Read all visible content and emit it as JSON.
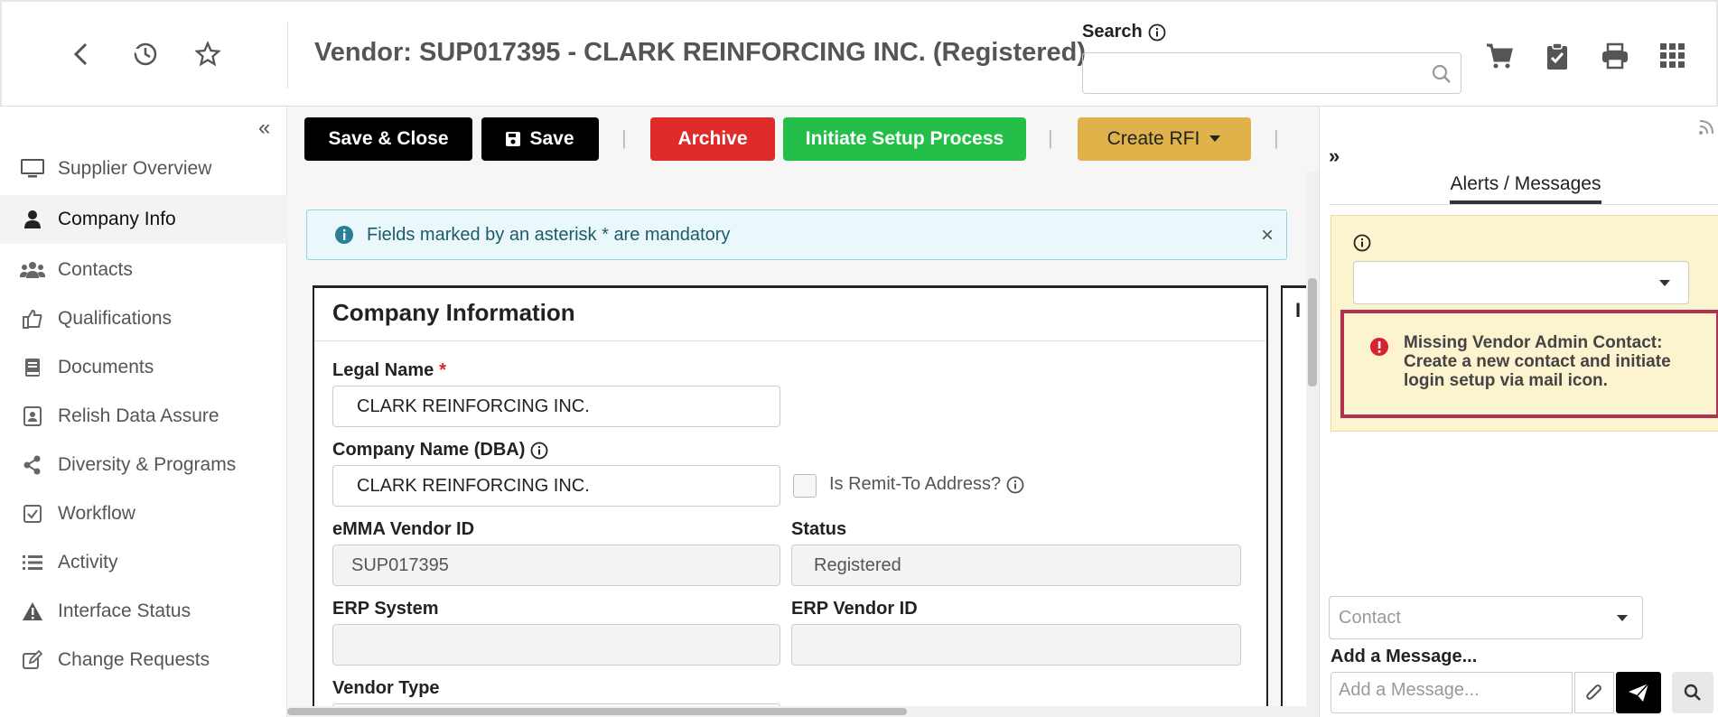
{
  "header": {
    "title": "Vendor: SUP017395 - CLARK REINFORCING INC. (Registered)",
    "search_label": "Search",
    "search_value": ""
  },
  "sidebar": {
    "items": [
      {
        "label": "Supplier Overview",
        "icon": "monitor-icon"
      },
      {
        "label": "Company Info",
        "icon": "user-icon",
        "active": true
      },
      {
        "label": "Contacts",
        "icon": "users-icon"
      },
      {
        "label": "Qualifications",
        "icon": "thumbs-up-icon"
      },
      {
        "label": "Documents",
        "icon": "book-icon"
      },
      {
        "label": "Relish Data Assure",
        "icon": "id-card-icon"
      },
      {
        "label": "Diversity & Programs",
        "icon": "share-icon"
      },
      {
        "label": "Workflow",
        "icon": "checkbox-icon"
      },
      {
        "label": "Activity",
        "icon": "list-icon"
      },
      {
        "label": "Interface Status",
        "icon": "warning-icon"
      },
      {
        "label": "Change Requests",
        "icon": "edit-icon"
      }
    ]
  },
  "toolbar": {
    "save_close": "Save & Close",
    "save": "Save",
    "archive": "Archive",
    "initiate_setup": "Initiate Setup Process",
    "create_rfi": "Create RFI"
  },
  "notice": {
    "text": "Fields marked by an asterisk * are mandatory",
    "close": "×"
  },
  "company_info": {
    "title": "Company Information",
    "legal_name_label": "Legal Name",
    "required_mark": "*",
    "legal_name": "CLARK REINFORCING INC.",
    "dba_label": "Company Name (DBA)",
    "dba": "CLARK REINFORCING INC.",
    "remit_label": "Is Remit-To Address?",
    "emma_id_label": "eMMA Vendor ID",
    "emma_id": "SUP017395",
    "status_label": "Status",
    "status": "Registered",
    "erp_system_label": "ERP System",
    "erp_system": "",
    "erp_vendor_id_label": "ERP Vendor ID",
    "erp_vendor_id": "",
    "vendor_type_label": "Vendor Type"
  },
  "right_panel": {
    "tab": "Alerts / Messages",
    "error_message": "Missing Vendor Admin Contact: Create a new contact and initiate login setup via mail icon.",
    "contact_placeholder": "Contact",
    "add_message_label": "Add a Message...",
    "message_placeholder": "Add a Message..."
  },
  "colors": {
    "save_close": "#000000",
    "archive": "#e02b2b",
    "initiate": "#24bf49",
    "create_rfi": "#e0b24a",
    "error_border": "#b3314f",
    "warning_bg": "#fcf3cf"
  }
}
